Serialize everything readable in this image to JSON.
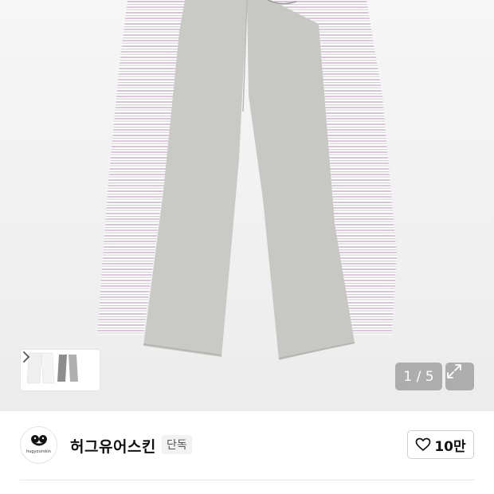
{
  "gallery": {
    "counter": "1 / 5",
    "thumbnail_alt": "product-thumbnail",
    "icons": {
      "next": "chevron-right-icon",
      "expand": "expand-icon"
    }
  },
  "brand": {
    "name": "허그유어스킨",
    "badge": "단독",
    "logo_text": "hugyourskin",
    "likes": "10만",
    "icons": {
      "like": "heart-icon"
    }
  },
  "colors": {
    "pants": "#c9cac6",
    "stripe_pink": "#d6bfd6",
    "stripe_gray": "#c7c7c7"
  }
}
